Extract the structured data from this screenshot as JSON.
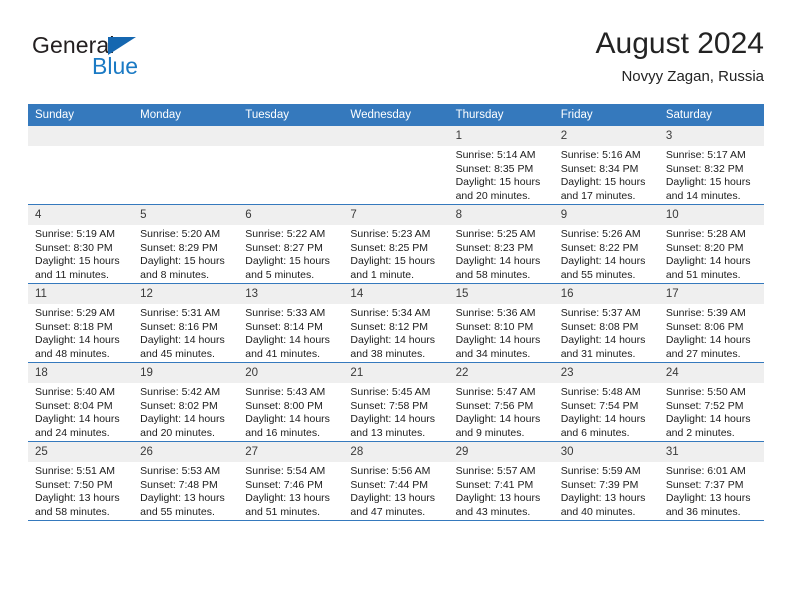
{
  "brand": {
    "name_top": "General",
    "name_bottom": "Blue",
    "triangle_color": "#1567b0",
    "blue_color": "#1b7ac4",
    "icon": "triangle-icon"
  },
  "header": {
    "title": "August 2024",
    "subtitle": "Novyy Zagan, Russia",
    "accent_color": "#3579bd"
  },
  "calendar": {
    "weekday_headers": [
      "Sunday",
      "Monday",
      "Tuesday",
      "Wednesday",
      "Thursday",
      "Friday",
      "Saturday"
    ],
    "header_bg": "#3579bd",
    "daynum_bg": "#efefef",
    "weeks": [
      [
        {
          "day": "",
          "lines": [],
          "empty": true
        },
        {
          "day": "",
          "lines": [],
          "empty": true
        },
        {
          "day": "",
          "lines": [],
          "empty": true
        },
        {
          "day": "",
          "lines": [],
          "empty": true
        },
        {
          "day": "1",
          "lines": [
            "Sunrise: 5:14 AM",
            "Sunset: 8:35 PM",
            "Daylight: 15 hours",
            "and 20 minutes."
          ]
        },
        {
          "day": "2",
          "lines": [
            "Sunrise: 5:16 AM",
            "Sunset: 8:34 PM",
            "Daylight: 15 hours",
            "and 17 minutes."
          ]
        },
        {
          "day": "3",
          "lines": [
            "Sunrise: 5:17 AM",
            "Sunset: 8:32 PM",
            "Daylight: 15 hours",
            "and 14 minutes."
          ]
        }
      ],
      [
        {
          "day": "4",
          "lines": [
            "Sunrise: 5:19 AM",
            "Sunset: 8:30 PM",
            "Daylight: 15 hours",
            "and 11 minutes."
          ]
        },
        {
          "day": "5",
          "lines": [
            "Sunrise: 5:20 AM",
            "Sunset: 8:29 PM",
            "Daylight: 15 hours",
            "and 8 minutes."
          ]
        },
        {
          "day": "6",
          "lines": [
            "Sunrise: 5:22 AM",
            "Sunset: 8:27 PM",
            "Daylight: 15 hours",
            "and 5 minutes."
          ]
        },
        {
          "day": "7",
          "lines": [
            "Sunrise: 5:23 AM",
            "Sunset: 8:25 PM",
            "Daylight: 15 hours",
            "and 1 minute."
          ]
        },
        {
          "day": "8",
          "lines": [
            "Sunrise: 5:25 AM",
            "Sunset: 8:23 PM",
            "Daylight: 14 hours",
            "and 58 minutes."
          ]
        },
        {
          "day": "9",
          "lines": [
            "Sunrise: 5:26 AM",
            "Sunset: 8:22 PM",
            "Daylight: 14 hours",
            "and 55 minutes."
          ]
        },
        {
          "day": "10",
          "lines": [
            "Sunrise: 5:28 AM",
            "Sunset: 8:20 PM",
            "Daylight: 14 hours",
            "and 51 minutes."
          ]
        }
      ],
      [
        {
          "day": "11",
          "lines": [
            "Sunrise: 5:29 AM",
            "Sunset: 8:18 PM",
            "Daylight: 14 hours",
            "and 48 minutes."
          ]
        },
        {
          "day": "12",
          "lines": [
            "Sunrise: 5:31 AM",
            "Sunset: 8:16 PM",
            "Daylight: 14 hours",
            "and 45 minutes."
          ]
        },
        {
          "day": "13",
          "lines": [
            "Sunrise: 5:33 AM",
            "Sunset: 8:14 PM",
            "Daylight: 14 hours",
            "and 41 minutes."
          ]
        },
        {
          "day": "14",
          "lines": [
            "Sunrise: 5:34 AM",
            "Sunset: 8:12 PM",
            "Daylight: 14 hours",
            "and 38 minutes."
          ]
        },
        {
          "day": "15",
          "lines": [
            "Sunrise: 5:36 AM",
            "Sunset: 8:10 PM",
            "Daylight: 14 hours",
            "and 34 minutes."
          ]
        },
        {
          "day": "16",
          "lines": [
            "Sunrise: 5:37 AM",
            "Sunset: 8:08 PM",
            "Daylight: 14 hours",
            "and 31 minutes."
          ]
        },
        {
          "day": "17",
          "lines": [
            "Sunrise: 5:39 AM",
            "Sunset: 8:06 PM",
            "Daylight: 14 hours",
            "and 27 minutes."
          ]
        }
      ],
      [
        {
          "day": "18",
          "lines": [
            "Sunrise: 5:40 AM",
            "Sunset: 8:04 PM",
            "Daylight: 14 hours",
            "and 24 minutes."
          ]
        },
        {
          "day": "19",
          "lines": [
            "Sunrise: 5:42 AM",
            "Sunset: 8:02 PM",
            "Daylight: 14 hours",
            "and 20 minutes."
          ]
        },
        {
          "day": "20",
          "lines": [
            "Sunrise: 5:43 AM",
            "Sunset: 8:00 PM",
            "Daylight: 14 hours",
            "and 16 minutes."
          ]
        },
        {
          "day": "21",
          "lines": [
            "Sunrise: 5:45 AM",
            "Sunset: 7:58 PM",
            "Daylight: 14 hours",
            "and 13 minutes."
          ]
        },
        {
          "day": "22",
          "lines": [
            "Sunrise: 5:47 AM",
            "Sunset: 7:56 PM",
            "Daylight: 14 hours",
            "and 9 minutes."
          ]
        },
        {
          "day": "23",
          "lines": [
            "Sunrise: 5:48 AM",
            "Sunset: 7:54 PM",
            "Daylight: 14 hours",
            "and 6 minutes."
          ]
        },
        {
          "day": "24",
          "lines": [
            "Sunrise: 5:50 AM",
            "Sunset: 7:52 PM",
            "Daylight: 14 hours",
            "and 2 minutes."
          ]
        }
      ],
      [
        {
          "day": "25",
          "lines": [
            "Sunrise: 5:51 AM",
            "Sunset: 7:50 PM",
            "Daylight: 13 hours",
            "and 58 minutes."
          ]
        },
        {
          "day": "26",
          "lines": [
            "Sunrise: 5:53 AM",
            "Sunset: 7:48 PM",
            "Daylight: 13 hours",
            "and 55 minutes."
          ]
        },
        {
          "day": "27",
          "lines": [
            "Sunrise: 5:54 AM",
            "Sunset: 7:46 PM",
            "Daylight: 13 hours",
            "and 51 minutes."
          ]
        },
        {
          "day": "28",
          "lines": [
            "Sunrise: 5:56 AM",
            "Sunset: 7:44 PM",
            "Daylight: 13 hours",
            "and 47 minutes."
          ]
        },
        {
          "day": "29",
          "lines": [
            "Sunrise: 5:57 AM",
            "Sunset: 7:41 PM",
            "Daylight: 13 hours",
            "and 43 minutes."
          ]
        },
        {
          "day": "30",
          "lines": [
            "Sunrise: 5:59 AM",
            "Sunset: 7:39 PM",
            "Daylight: 13 hours",
            "and 40 minutes."
          ]
        },
        {
          "day": "31",
          "lines": [
            "Sunrise: 6:01 AM",
            "Sunset: 7:37 PM",
            "Daylight: 13 hours",
            "and 36 minutes."
          ]
        }
      ]
    ]
  }
}
